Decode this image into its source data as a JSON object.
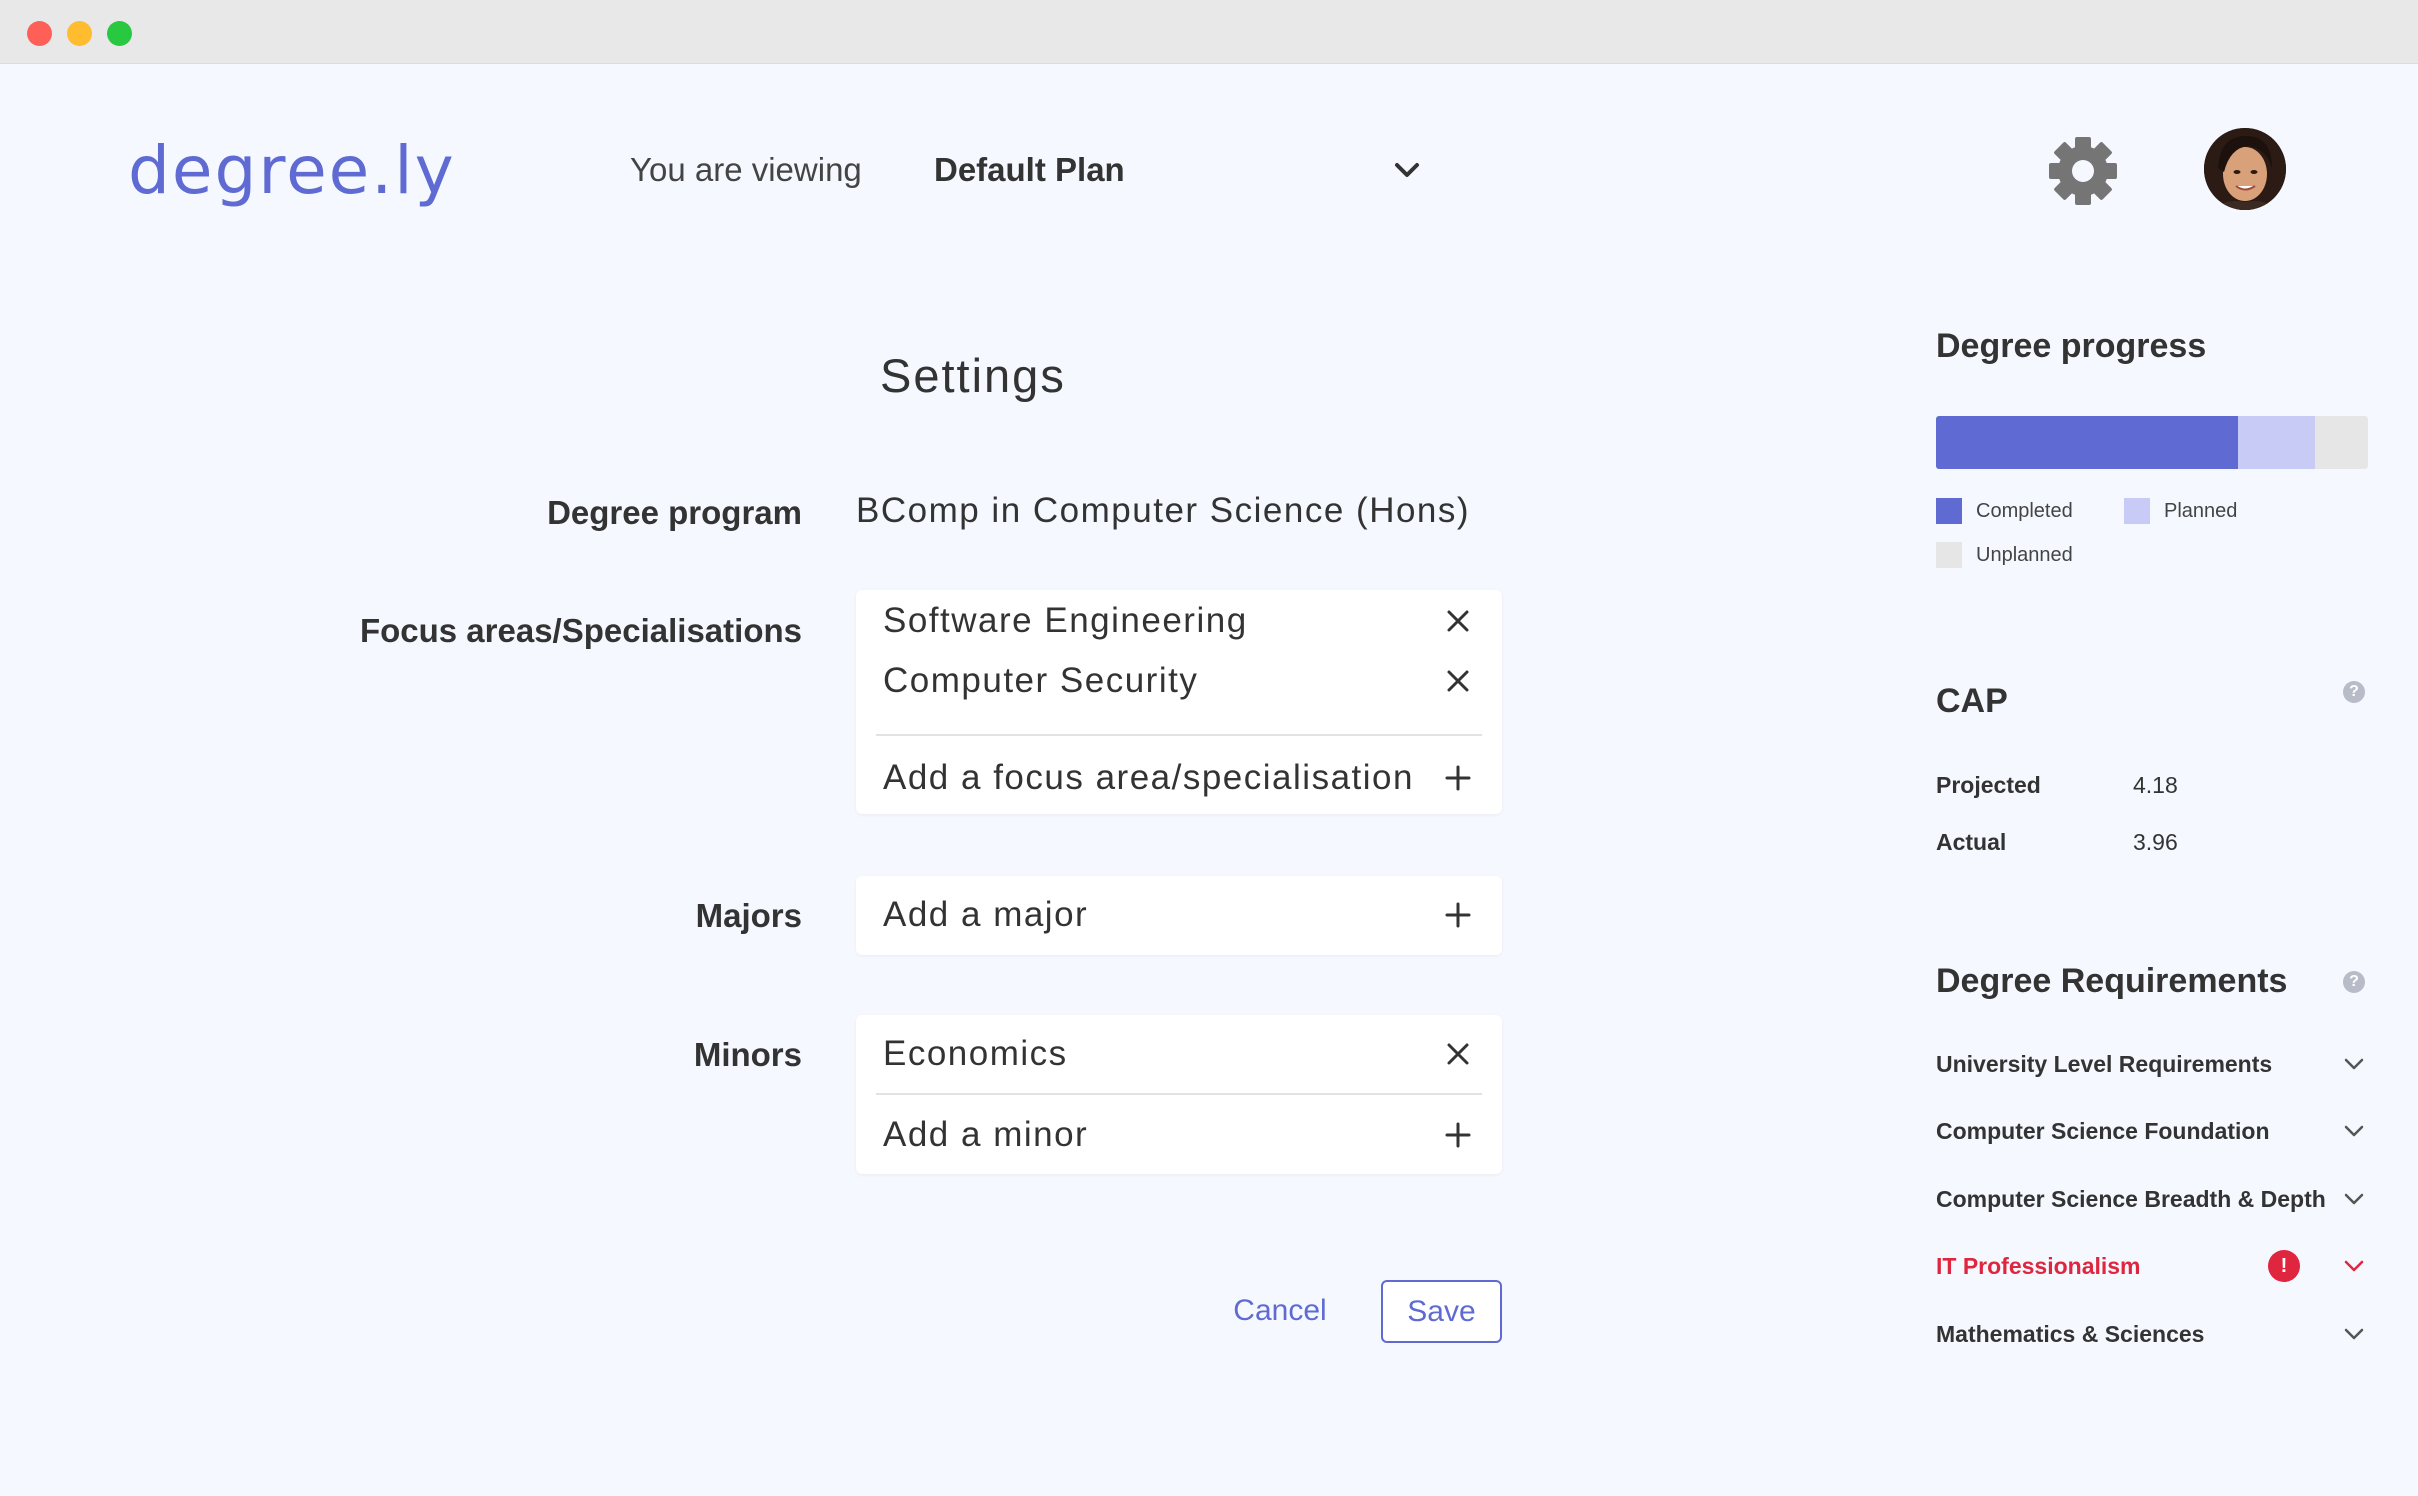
{
  "app": {
    "logo": "degree.ly",
    "viewing_label": "You are viewing",
    "plan_selected": "Default Plan"
  },
  "icons": {
    "gear": "gear-icon",
    "avatar": "user-avatar",
    "chevron": "chevron-down-icon",
    "close": "close-icon",
    "add": "plus-icon",
    "help": "help-icon",
    "warning": "warning-icon"
  },
  "settings": {
    "title": "Settings",
    "degree_program_label": "Degree program",
    "degree_program_value": "BComp in Computer Science (Hons)",
    "focus_label": "Focus areas/Specialisations",
    "focus_items": [
      "Software Engineering",
      "Computer Security"
    ],
    "focus_add": "Add a focus area/specialisation",
    "majors_label": "Majors",
    "majors_add": "Add a major",
    "minors_label": "Minors",
    "minor_items": [
      "Economics"
    ],
    "minors_add": "Add a minor",
    "cancel": "Cancel",
    "save": "Save"
  },
  "sidebar": {
    "progress_title": "Degree progress",
    "progress": {
      "completed_fraction": 0.7,
      "planned_fraction": 0.178
    },
    "legend": {
      "completed": "Completed",
      "planned": "Planned",
      "unplanned": "Unplanned"
    },
    "cap_title": "CAP",
    "cap": [
      {
        "label": "Projected",
        "value": "4.18"
      },
      {
        "label": "Actual",
        "value": "3.96"
      }
    ],
    "requirements_title": "Degree Requirements",
    "requirements": [
      {
        "label": "University Level Requirements",
        "alert": false
      },
      {
        "label": "Computer Science Foundation",
        "alert": false
      },
      {
        "label": "Computer Science Breadth & Depth",
        "alert": false
      },
      {
        "label": "IT Professionalism",
        "alert": true,
        "alert_symbol": "!"
      },
      {
        "label": "Mathematics & Sciences",
        "alert": false
      }
    ]
  },
  "colors": {
    "accent": "#5f6bd2",
    "planned": "#c8cbf6",
    "unplanned": "#e6e6e6",
    "alert": "#e0263f",
    "background": "#f5f8fe"
  }
}
